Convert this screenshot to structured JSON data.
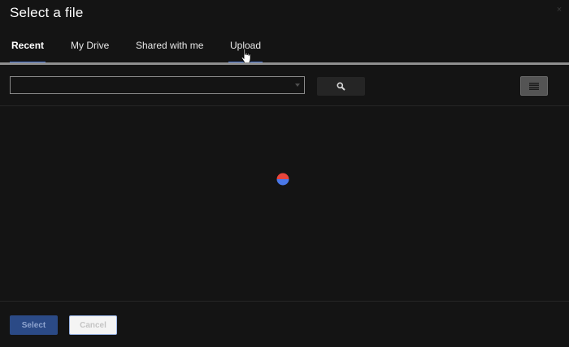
{
  "dialog": {
    "title": "Select a file",
    "close_glyph": "×"
  },
  "tabs": [
    {
      "label": "Recent",
      "active": true
    },
    {
      "label": "My Drive",
      "active": false
    },
    {
      "label": "Shared with me",
      "active": false
    },
    {
      "label": "Upload",
      "active": false,
      "hovered": true
    }
  ],
  "toolbar": {
    "search_value": "",
    "search_icon": "magnifier-icon",
    "view_icon": "list-view-icon"
  },
  "content": {
    "loading": true,
    "spinner_colors": [
      "#e8453c",
      "#4a78e8"
    ]
  },
  "footer": {
    "select_label": "Select",
    "cancel_label": "Cancel"
  },
  "colors": {
    "background": "#141414",
    "accent": "#4a78d8",
    "primary_button": "#2b4a86"
  }
}
